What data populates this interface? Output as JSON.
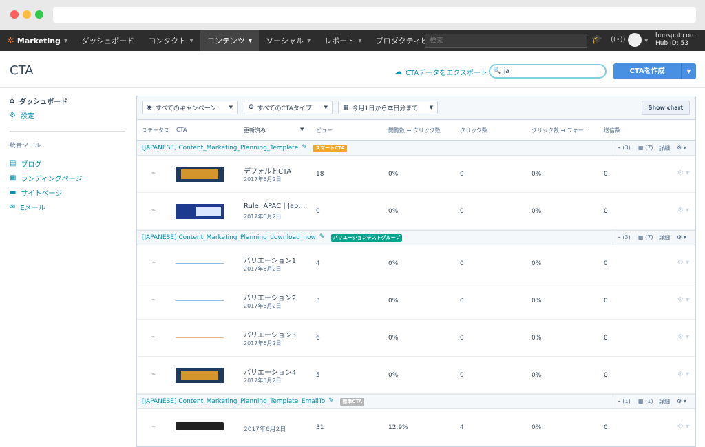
{
  "nav": {
    "brand": "Marketing",
    "items": [
      "ダッシュボード",
      "コンタクト",
      "コンテンツ",
      "ソーシャル",
      "レポート",
      "プロダクティビティ"
    ],
    "search_placeholder": "検索",
    "portal_domain": "hubspot.com",
    "hub_id": "Hub ID: 53"
  },
  "page": {
    "title": "CTA",
    "export_label": "CTAデータをエクスポート",
    "search_value": "ja",
    "create_label": "CTAを作成"
  },
  "sidebar": {
    "dashboard": "ダッシュボード",
    "settings": "設定",
    "section": "統合ツール",
    "tools": [
      "ブログ",
      "ランディングページ",
      "サイトページ",
      "Eメール"
    ]
  },
  "toolbar": {
    "campaign": "すべてのキャンペーン",
    "type": "すべてのCTAタイプ",
    "range": "今月1日から本日分まで",
    "show_chart": "Show chart"
  },
  "columns": [
    "ステータス",
    "CTA",
    "更新済み",
    "ビュー",
    "閲覧数 → クリック数",
    "クリック数",
    "クリック数 → フォー…",
    "送信数"
  ],
  "groups": [
    {
      "name": "[JAPANESE] Content_Marketing_Planning_Template",
      "badge": "スマートCTA",
      "badge_color": "#f5a623",
      "tools": {
        "views": "(3)",
        "variants": "(7)",
        "detail": "詳細"
      },
      "rows": [
        {
          "name": "デフォルトCTA",
          "date": "2017年6月2日",
          "views": "18",
          "rate": "0%",
          "clicks": "0",
          "submit_rate": "0%",
          "submissions": "0",
          "thumb": "image"
        },
        {
          "name": "Rule: APAC | Japa…",
          "date": "2017年6月2日",
          "views": "0",
          "rate": "0%",
          "clicks": "0",
          "submit_rate": "0%",
          "submissions": "0",
          "thumb": "image2"
        }
      ]
    },
    {
      "name": "[JAPANESE] Content_Marketing_Planning_download_now",
      "badge": "バリエーションテストグループ",
      "badge_color": "#00a38d",
      "tools": {
        "views": "(3)",
        "variants": "(7)",
        "detail": "詳細"
      },
      "rows": [
        {
          "name": "バリエーション1",
          "date": "2017年6月2日",
          "views": "4",
          "rate": "0%",
          "clicks": "0",
          "submit_rate": "0%",
          "submissions": "0",
          "thumb": "line-blue"
        },
        {
          "name": "バリエーション2",
          "date": "2017年6月2日",
          "views": "3",
          "rate": "0%",
          "clicks": "0",
          "submit_rate": "0%",
          "submissions": "0",
          "thumb": "line-blue"
        },
        {
          "name": "バリエーション3",
          "date": "2017年6月2日",
          "views": "6",
          "rate": "0%",
          "clicks": "0",
          "submit_rate": "0%",
          "submissions": "0",
          "thumb": "line-orange"
        },
        {
          "name": "バリエーション4",
          "date": "2017年6月2日",
          "views": "5",
          "rate": "0%",
          "clicks": "0",
          "submit_rate": "0%",
          "submissions": "0",
          "thumb": "image"
        }
      ]
    },
    {
      "name": "[JAPANESE] Content_Marketing_Planning_Template_EmailTo",
      "badge": "標準CTA",
      "badge_color": "#b5b5b5",
      "tools": {
        "views": "(1)",
        "variants": "(1)",
        "detail": "詳細"
      },
      "rows": [
        {
          "name": "",
          "date": "2017年6月2日",
          "views": "31",
          "rate": "12.9%",
          "clicks": "4",
          "submit_rate": "0%",
          "submissions": "0",
          "thumb": "dark-button"
        }
      ]
    }
  ]
}
